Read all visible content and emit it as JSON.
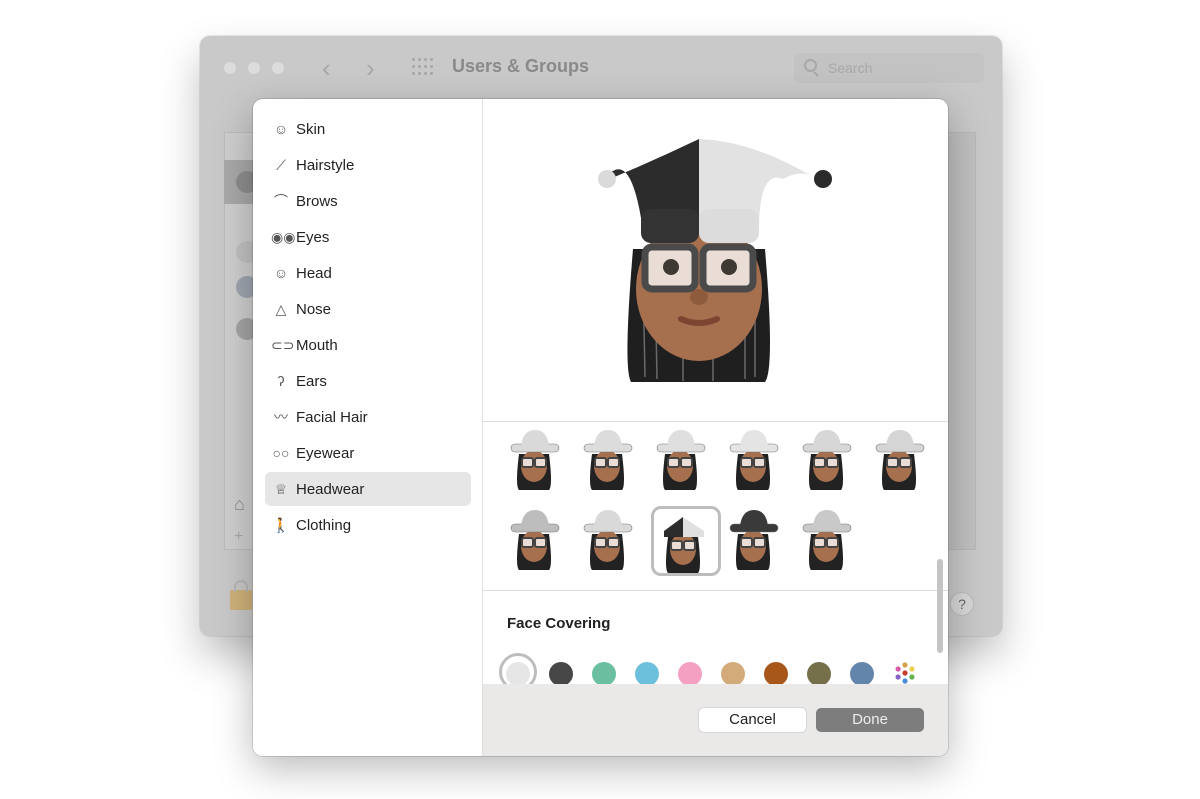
{
  "window": {
    "title": "Users & Groups",
    "search_placeholder": "Search",
    "help_label": "?"
  },
  "sidebar": {
    "items": [
      {
        "label": "Skin",
        "icon": "skin-face-icon",
        "glyph": "☺"
      },
      {
        "label": "Hairstyle",
        "icon": "comb-icon",
        "glyph": "⟋"
      },
      {
        "label": "Brows",
        "icon": "brows-icon",
        "glyph": "⌒"
      },
      {
        "label": "Eyes",
        "icon": "eyes-icon",
        "glyph": "◉◉"
      },
      {
        "label": "Head",
        "icon": "head-icon",
        "glyph": "☺"
      },
      {
        "label": "Nose",
        "icon": "nose-icon",
        "glyph": "△"
      },
      {
        "label": "Mouth",
        "icon": "mouth-icon",
        "glyph": "⊂⊃"
      },
      {
        "label": "Ears",
        "icon": "ear-icon",
        "glyph": "ʔ"
      },
      {
        "label": "Facial Hair",
        "icon": "mustache-icon",
        "glyph": "〰"
      },
      {
        "label": "Eyewear",
        "icon": "glasses-icon",
        "glyph": "○○"
      },
      {
        "label": "Headwear",
        "icon": "crown-icon",
        "glyph": "♕",
        "selected": true
      },
      {
        "label": "Clothing",
        "icon": "person-walking-icon",
        "glyph": "🚶"
      }
    ]
  },
  "preview": {
    "description": "Memoji wearing black-and-white jester hat"
  },
  "headwear_options": [
    {
      "name": "cowboy-hat"
    },
    {
      "name": "fedora"
    },
    {
      "name": "panama-hat"
    },
    {
      "name": "top-hat"
    },
    {
      "name": "bucket-hat"
    },
    {
      "name": "wide-brim-hat"
    },
    {
      "name": "castle-crown"
    },
    {
      "name": "wizard-hat"
    },
    {
      "name": "jester-hat",
      "selected": true
    },
    {
      "name": "beanie"
    },
    {
      "name": "crown"
    }
  ],
  "face_covering": {
    "title": "Face Covering",
    "colors": [
      "#e6e6e6",
      "#474747",
      "#6bbfa0",
      "#6cc0dc",
      "#f3a0c3",
      "#d3ab7b",
      "#a8571a",
      "#76704a",
      "#6485ab"
    ],
    "selected_index": 0,
    "more_colors_icon": "multicolor-palette-icon"
  },
  "footer": {
    "cancel_label": "Cancel",
    "done_label": "Done"
  }
}
